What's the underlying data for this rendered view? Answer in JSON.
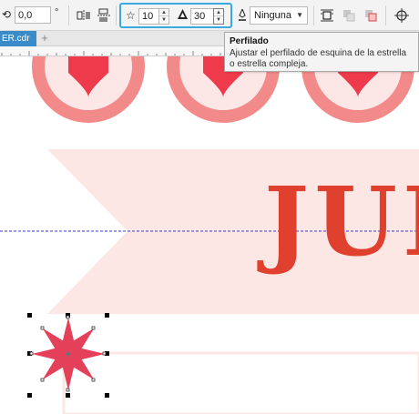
{
  "property_bar": {
    "rotation_value": "0,0",
    "degree_symbol": "°",
    "star_points": "10",
    "star_sharpness": "30",
    "outline_width": "Ninguna"
  },
  "tabs": {
    "doc_tab": "ER.cdr",
    "add_tab": "+"
  },
  "tooltip": {
    "title": "Perfilado",
    "body": "Ajustar el perfilado de esquina de la estrella o estrella compleja."
  },
  "canvas": {
    "banner_text": "JUI"
  },
  "icons": {
    "rotation": "rotate-icon",
    "star": "star-icon",
    "sharpness": "sharpness-icon",
    "outline": "pen-outline-icon"
  },
  "colors": {
    "accent_blue": "#39a9e0",
    "tab_blue": "#3a8bc9",
    "circle_ring": "#f28a8a",
    "circle_fill": "#fde6e6",
    "heart": "#ee3a4a",
    "banner": "#fde7e5",
    "lettering": "#e0412f",
    "star_fill": "#e5405a"
  }
}
